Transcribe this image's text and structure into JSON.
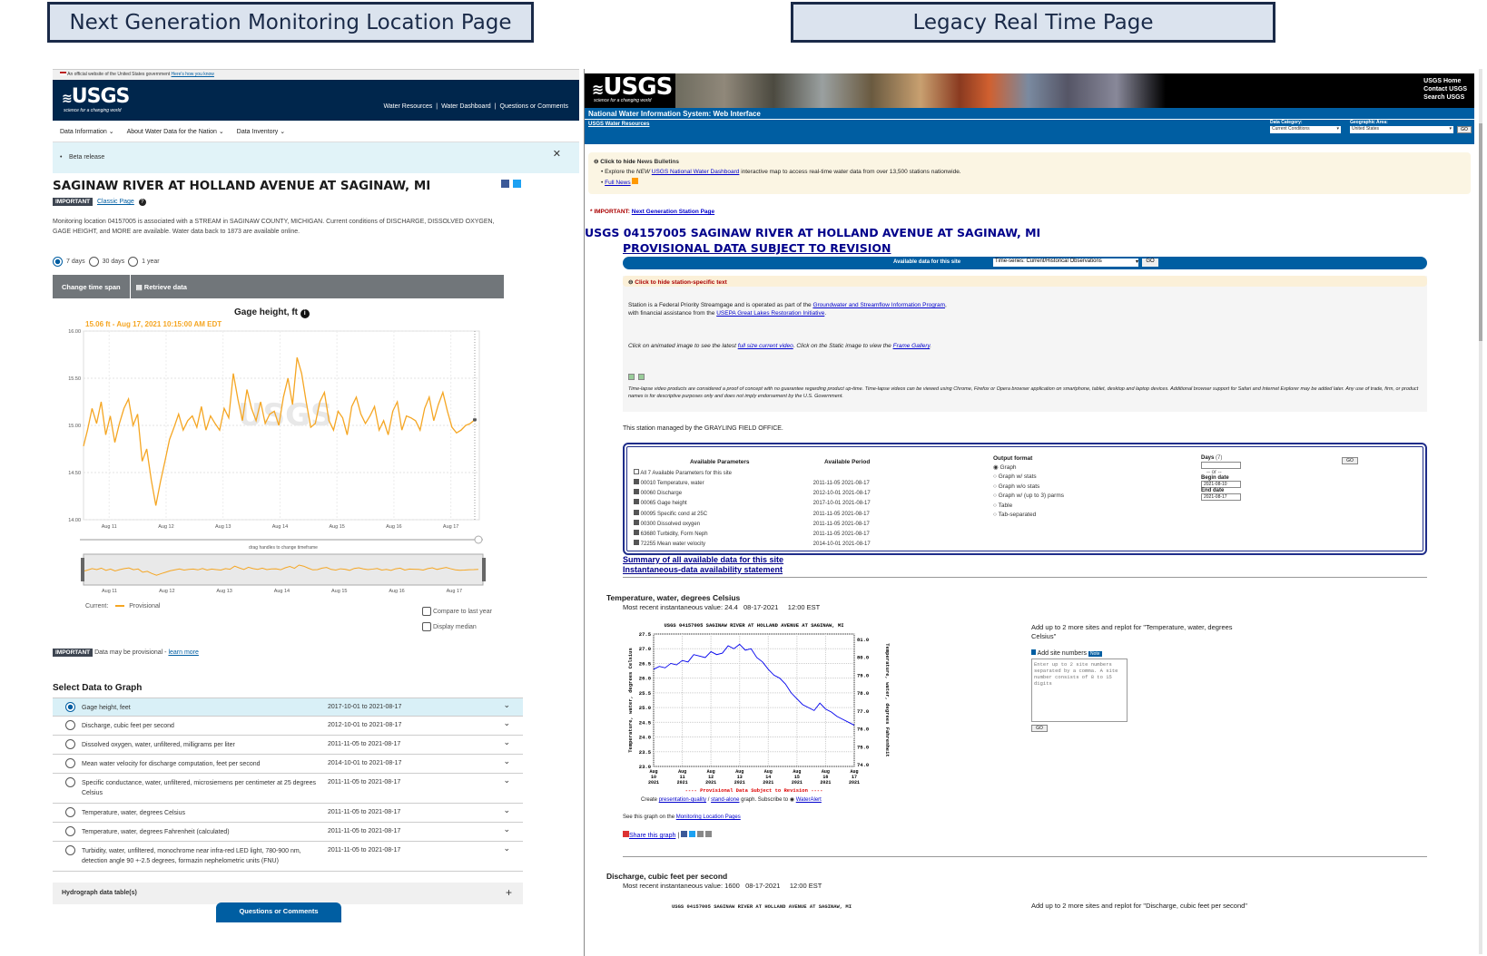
{
  "titles": {
    "left_banner": "Next Generation Monitoring Location Page",
    "right_banner": "Legacy Real Time Page"
  },
  "left": {
    "gov_banner": "An official website of the United States government",
    "gov_link": "Here's how you know",
    "logo": "USGS",
    "logo_tagline": "science for a changing world",
    "topnav": [
      "Water Resources",
      "Water Dashboard",
      "Questions or Comments"
    ],
    "subnav": [
      "Data Information",
      "About Water Data for the Nation",
      "Data Inventory"
    ],
    "beta": "Beta release",
    "site_title": "SAGINAW RIVER AT HOLLAND AVENUE AT SAGINAW, MI",
    "important": "IMPORTANT",
    "classic_page": "Classic Page",
    "description": "Monitoring location 04157005 is associated with a STREAM in SAGINAW COUNTY, MICHIGAN. Current conditions of DISCHARGE, DISSOLVED OXYGEN, GAGE HEIGHT, and MORE are available. Water data back to 1873 are available online.",
    "time_options": [
      "7 days",
      "30 days",
      "1 year"
    ],
    "change_time": "Change time span",
    "retrieve": "Retrieve data",
    "graph_title": "Gage height, ft",
    "graph_current": "15.06 ft - Aug 17, 2021 10:15:00 AM EDT",
    "drag_hint": "drag handles to change timeframe",
    "legend_current": "Current:",
    "legend_prov": "Provisional",
    "compare": "Compare to last year",
    "median": "Display median",
    "provisional_note": "Data may be provisional -",
    "learn_more": "learn more",
    "select_data": "Select Data to Graph",
    "params": [
      {
        "name": "Gage height, feet",
        "period": "2017-10-01 to 2021-08-17"
      },
      {
        "name": "Discharge, cubic feet per second",
        "period": "2012-10-01 to 2021-08-17"
      },
      {
        "name": "Dissolved oxygen, water, unfiltered, milligrams per liter",
        "period": "2011-11-05 to 2021-08-17"
      },
      {
        "name": "Mean water velocity for discharge computation, feet per second",
        "period": "2014-10-01 to 2021-08-17"
      },
      {
        "name": "Specific conductance, water, unfiltered, microsiemens per centimeter at 25 degrees Celsius",
        "period": "2011-11-05 to 2021-08-17"
      },
      {
        "name": "Temperature, water, degrees Celsius",
        "period": "2011-11-05 to 2021-08-17"
      },
      {
        "name": "Temperature, water, degrees Fahrenheit (calculated)",
        "period": "2011-11-05 to 2021-08-17"
      },
      {
        "name": "Turbidity, water, unfiltered, monochrome near infra-red LED light, 780-900 nm, detection angle 90 +-2.5 degrees, formazin nephelometric units (FNU)",
        "period": "2011-11-05 to 2021-08-17"
      }
    ],
    "hydrograph": "Hydrograph data table(s)",
    "questions": "Questions or Comments",
    "chart_data": {
      "type": "line",
      "title": "Gage height, ft",
      "ylabel": "",
      "ylim": [
        14.0,
        16.0
      ],
      "yticks": [
        "16.00",
        "15.50",
        "15.00",
        "14.50",
        "14.00"
      ],
      "categories": [
        "Aug 11",
        "Aug 12",
        "Aug 13",
        "Aug 14",
        "Aug 15",
        "Aug 16",
        "Aug 17"
      ],
      "xlim": [
        10.55,
        17.5
      ],
      "series": [
        {
          "x": [
            10.55,
            10.62,
            10.7,
            10.78,
            10.86,
            10.94,
            11.02,
            11.1,
            11.18,
            11.26,
            11.34,
            11.42,
            11.5,
            11.58,
            11.66,
            11.74,
            11.82,
            11.9,
            11.98,
            12.06,
            12.14,
            12.22,
            12.3,
            12.38,
            12.46,
            12.54,
            12.62,
            12.7,
            12.78,
            12.86,
            12.94,
            13.02,
            13.1,
            13.18,
            13.26,
            13.34,
            13.42,
            13.5,
            13.58,
            13.66,
            13.74,
            13.82,
            13.9,
            13.98,
            14.06,
            14.14,
            14.22,
            14.3,
            14.38,
            14.46,
            14.54,
            14.62,
            14.7,
            14.78,
            14.86,
            14.94,
            15.02,
            15.1,
            15.18,
            15.26,
            15.34,
            15.42,
            15.5,
            15.58,
            15.66,
            15.74,
            15.82,
            15.9,
            15.98,
            16.06,
            16.14,
            16.22,
            16.3,
            16.38,
            16.46,
            16.54,
            16.62,
            16.7,
            16.78,
            16.86,
            16.94,
            17.02,
            17.1,
            17.18,
            17.26,
            17.34,
            17.42
          ],
          "values": [
            14.78,
            14.95,
            15.18,
            15.02,
            15.25,
            14.9,
            15.1,
            14.82,
            15.02,
            15.18,
            15.28,
            15.0,
            15.12,
            14.62,
            14.75,
            14.42,
            14.15,
            14.4,
            14.62,
            14.85,
            14.98,
            15.12,
            14.95,
            15.05,
            15.1,
            14.98,
            15.2,
            14.95,
            15.1,
            15.02,
            14.95,
            15.18,
            15.08,
            15.55,
            15.28,
            15.05,
            15.38,
            15.18,
            15.05,
            15.25,
            15.02,
            15.12,
            15.15,
            15.0,
            15.3,
            15.5,
            15.22,
            15.72,
            15.55,
            15.25,
            14.98,
            15.02,
            15.25,
            15.35,
            15.05,
            14.95,
            15.15,
            15.08,
            14.9,
            15.2,
            15.3,
            15.12,
            15.02,
            15.1,
            15.2,
            14.95,
            15.05,
            14.9,
            15.15,
            15.25,
            14.95,
            15.1,
            15.08,
            15.05,
            14.95,
            15.18,
            15.3,
            15.05,
            15.22,
            15.35,
            15.15,
            14.98,
            14.92,
            14.95,
            15.0,
            15.02,
            15.06
          ]
        }
      ],
      "brush_xlim": [
        10.55,
        17.5
      ]
    }
  },
  "right": {
    "logo": "USGS",
    "logo_tagline": "science for a changing world",
    "top_links": [
      "USGS Home",
      "Contact USGS",
      "Search USGS"
    ],
    "nwis": "National Water Information System: Web Interface",
    "water_resources": "USGS Water Resources",
    "data_category_label": "Data Category:",
    "data_category": "Current Conditions",
    "geo_area_label": "Geographic Area:",
    "geo_area": "United States",
    "go": "GO",
    "news_hide": "Click to hide",
    "news_title": "News Bulletins",
    "news_item_prefix": "Explore the",
    "news_new": "NEW",
    "news_dash": "USGS National Water Dashboard",
    "news_item_suffix": "interactive map to access real-time water data from over 13,500 stations nationwide.",
    "full_news": "Full News",
    "important": "* IMPORTANT:",
    "next_gen_link": "Next Generation Station Page",
    "station_title": "USGS 04157005 SAGINAW RIVER AT HOLLAND AVENUE AT SAGINAW, MI",
    "provisional": "PROVISIONAL DATA SUBJECT TO REVISION",
    "available_label": "Available data for this site",
    "available_value": "Time-series:   Current/Historical Observations",
    "hide_station": "Click to hide station-specific text",
    "station_text1": "Station is a Federal Priority Streamgage and is operated as part of the",
    "gsip": "Groundwater and Streamflow Information Program",
    "station_text2": "with financial assistance from the",
    "glri": "USEPA Great Lakes Restoration Initiative",
    "animated_text": "Click on animated image to see the latest",
    "full_size": "full size current video",
    "static_text": ". Click on the Static image to view the",
    "frame_gallery": "Frame Gallery",
    "timelapse": "Time-lapse video products are considered a proof of concept with no guarantee regarding product up-time. Time-lapse videos can be viewed using Chrome, Firefox or Opera browser application on smartphone, tablet, desktop and laptop devices. Additional browser support for Safari and Internet Explorer may be added later. Any use of trade, firm, or product names is for descriptive purposes only and does not imply endorsement by the U.S. Government.",
    "managed": "This station managed by the GRAYLING FIELD OFFICE.",
    "avail_params_hdr": "Available Parameters",
    "avail_period_hdr": "Available Period",
    "all_params": "All 7 Available Parameters for this site",
    "params": [
      {
        "name": "00010 Temperature, water",
        "period": "2011-11-05 2021-08-17"
      },
      {
        "name": "00060 Discharge",
        "period": "2012-10-01 2021-08-17"
      },
      {
        "name": "00065 Gage height",
        "period": "2017-10-01 2021-08-17"
      },
      {
        "name": "00095 Specific cond at 25C",
        "period": "2011-11-05 2021-08-17"
      },
      {
        "name": "00300 Dissolved oxygen",
        "period": "2011-11-05 2021-08-17"
      },
      {
        "name": "63680 Turbidity, Form Neph",
        "period": "2011-11-05 2021-08-17"
      },
      {
        "name": "72255 Mean water velocity",
        "period": "2014-10-01 2021-08-17"
      }
    ],
    "output_format": "Output format",
    "formats": [
      "Graph",
      "Graph w/ stats",
      "Graph w/o stats",
      "Graph w/ (up to 3) parms",
      "Table",
      "Tab-separated"
    ],
    "days_label": "Days",
    "days_value": "(7)",
    "or": "-- or --",
    "begin_label": "Begin date",
    "begin_value": "2021-08-10",
    "end_label": "End date",
    "end_value": "2021-08-17",
    "summary_link": "Summary of all available data for this site",
    "inst_link": "Instantaneous-data availability statement",
    "temp_title": "Temperature, water, degrees Celsius",
    "temp_recent": "Most recent instantaneous value: 24.4   08-17-2021     12:00 EST",
    "graph_heading": "USGS 04157005 SAGINAW RIVER AT HOLLAND AVENUE AT SAGINAW, MI",
    "provisional_graph": "---- Provisional Data Subject to Revision ----",
    "create_text": "Create",
    "pres_quality": "presentation-quality",
    "stand_alone": "stand-alone",
    "graph_subscribe": "graph.   Subscribe to",
    "waterwatch": "WaterAlert",
    "see_graph": "See this graph on the",
    "mlp": "Monitoring Location Pages",
    "share": "Share this graph",
    "add_sites": "Add up to 2 more sites and replot for \"Temperature, water, degrees Celsius\"",
    "add_site_numbers": "Add site numbers",
    "note": "Note",
    "textarea_ph": "Enter up to 2 site numbers separated by a comma. A site number consists of 8 to 15 digits",
    "discharge_title": "Discharge, cubic feet per second",
    "discharge_recent": "Most recent instantaneous value: 1600   08-17-2021     12:00 EST",
    "add_sites2": "Add up to 2 more sites and replot for \"Discharge, cubic feet per second\"",
    "chart_data": {
      "type": "line",
      "title": "USGS 04157005 SAGINAW RIVER AT HOLLAND AVENUE AT SAGINAW, MI",
      "ylabel": "Temperature, water, degrees Celsius",
      "y2label": "Temperature, water, degrees Fahrenheit",
      "ylim": [
        23.0,
        27.5
      ],
      "yticks": [
        "27.5",
        "27.0",
        "26.5",
        "26.0",
        "25.5",
        "25.0",
        "24.5",
        "24.0",
        "23.5",
        "23.0"
      ],
      "y2ticks": [
        "81.0",
        "80.0",
        "79.0",
        "78.0",
        "77.0",
        "76.0",
        "75.0",
        "74.0"
      ],
      "categories": [
        "Aug 10 2021",
        "Aug 11 2021",
        "Aug 12 2021",
        "Aug 13 2021",
        "Aug 14 2021",
        "Aug 15 2021",
        "Aug 16 2021",
        "Aug 17 2021"
      ],
      "xlim": [
        10.0,
        17.0
      ],
      "series": [
        {
          "x": [
            10.0,
            10.2,
            10.4,
            10.6,
            10.8,
            11.0,
            11.2,
            11.4,
            11.6,
            11.8,
            12.0,
            12.2,
            12.4,
            12.6,
            12.8,
            13.0,
            13.2,
            13.4,
            13.6,
            13.8,
            14.0,
            14.2,
            14.4,
            14.6,
            14.8,
            15.0,
            15.2,
            15.4,
            15.6,
            15.8,
            16.0,
            16.2,
            16.4,
            16.6,
            16.8,
            17.0
          ],
          "values": [
            26.3,
            26.4,
            26.35,
            26.5,
            26.45,
            26.6,
            26.55,
            26.8,
            26.75,
            26.7,
            26.9,
            26.8,
            26.85,
            27.1,
            27.0,
            27.15,
            26.95,
            27.0,
            26.7,
            26.55,
            26.3,
            26.1,
            26.0,
            25.8,
            25.5,
            25.3,
            25.1,
            25.0,
            24.9,
            25.15,
            24.95,
            24.85,
            24.7,
            24.6,
            24.5,
            24.4
          ]
        }
      ]
    }
  }
}
